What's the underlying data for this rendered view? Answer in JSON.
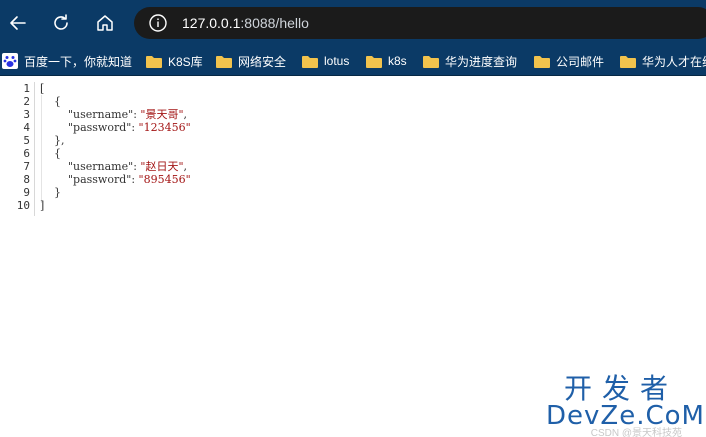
{
  "browser": {
    "url_host": "127.0.0.1",
    "url_rest": ":8088/hello",
    "icons": {
      "back": "arrow-left-icon",
      "reload": "reload-icon",
      "home": "home-icon",
      "info": "info-icon"
    }
  },
  "bookmarks": [
    {
      "label": "百度一下，你就知道",
      "icon": "baidu-paw-icon"
    },
    {
      "label": "K8S库",
      "icon": "folder-icon"
    },
    {
      "label": "网络安全",
      "icon": "folder-icon"
    },
    {
      "label": "lotus",
      "icon": "folder-icon"
    },
    {
      "label": "k8s",
      "icon": "folder-icon"
    },
    {
      "label": "华为进度查询",
      "icon": "folder-icon"
    },
    {
      "label": "公司邮件",
      "icon": "folder-icon"
    },
    {
      "label": "华为人才在线",
      "icon": "folder-icon"
    }
  ],
  "json_view": {
    "line_numbers": [
      "1",
      "2",
      "3",
      "4",
      "5",
      "6",
      "7",
      "8",
      "9",
      "10"
    ],
    "users": [
      {
        "username_key": "\"username\"",
        "username_value": "\"景天哥\"",
        "password_key": "\"password\"",
        "password_value": "\"123456\""
      },
      {
        "username_key": "\"username\"",
        "username_value": "\"赵日天\"",
        "password_key": "\"password\"",
        "password_value": "\"895456\""
      }
    ],
    "open_bracket": "[",
    "close_bracket": "]",
    "open_brace": "{",
    "close_brace_comma": "},",
    "close_brace": "}"
  },
  "watermark": {
    "cn": "开发者",
    "en": "DevZe.CoM",
    "sub": "CSDN @景天科技苑"
  },
  "colors": {
    "toolbar": "#0b3a66",
    "omnibox": "#1b1b1b",
    "string": "#a31515",
    "watermark": "#1f5fa8"
  }
}
